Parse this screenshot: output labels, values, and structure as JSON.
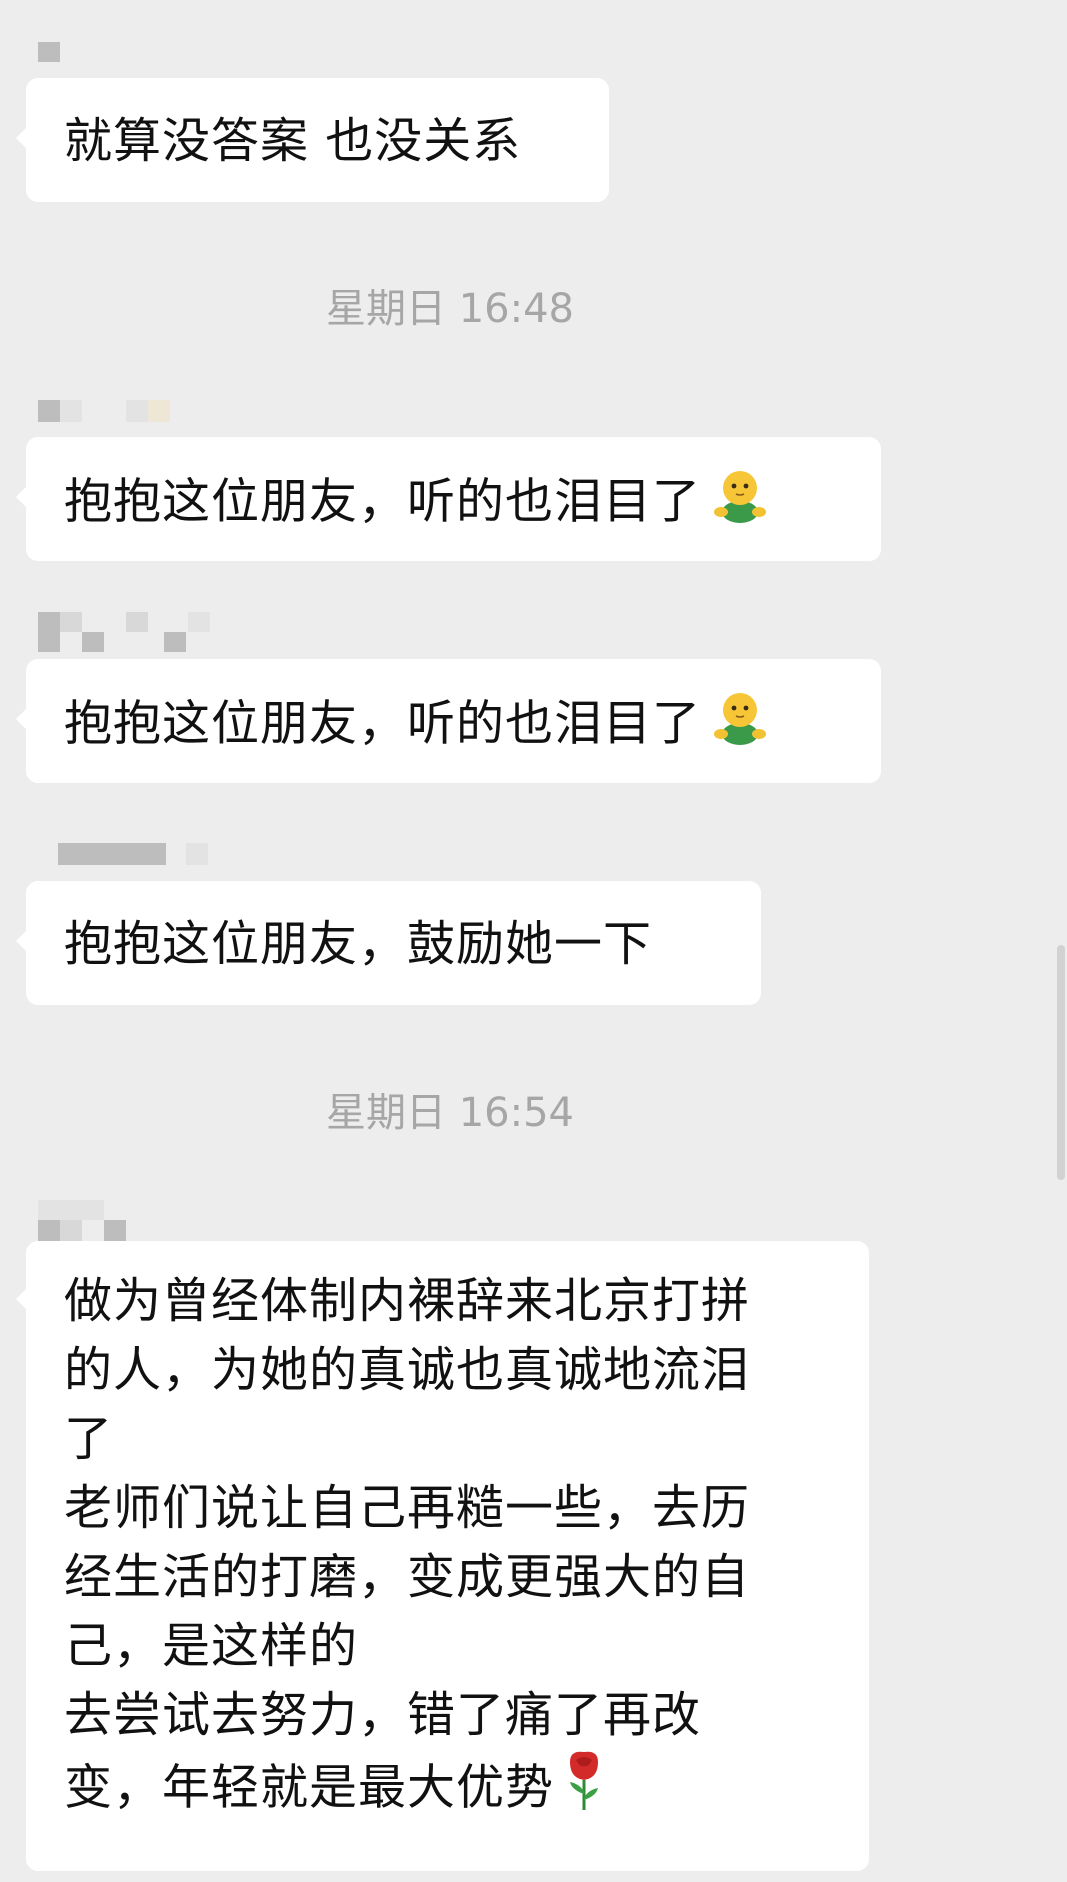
{
  "messages": [
    {
      "text": "就算没答案 也没关系"
    },
    {
      "text": "抱抱这位朋友，听的也泪目了",
      "emoji": "hugging-figure-icon"
    },
    {
      "text": "抱抱这位朋友，听的也泪目了",
      "emoji": "hugging-figure-icon"
    },
    {
      "text": "抱抱这位朋友，鼓励她一下"
    },
    {
      "lines": [
        "做为曾经体制内裸辞来北京打拼",
        "的人，为她的真诚也真诚地流泪",
        "了",
        "老师们说让自己再糙一些，去历",
        "经生活的打磨，变成更强大的自",
        "己，是这样的",
        "去尝试去努力，错了痛了再改",
        "变，年轻就是最大优势"
      ],
      "emoji": "rose-icon"
    }
  ],
  "timestamps": [
    "星期日 16:48",
    "星期日 16:54"
  ],
  "colors": {
    "background": "#ededed",
    "bubble": "#ffffff",
    "timestamp": "#a6a6a6",
    "text": "#111111"
  }
}
